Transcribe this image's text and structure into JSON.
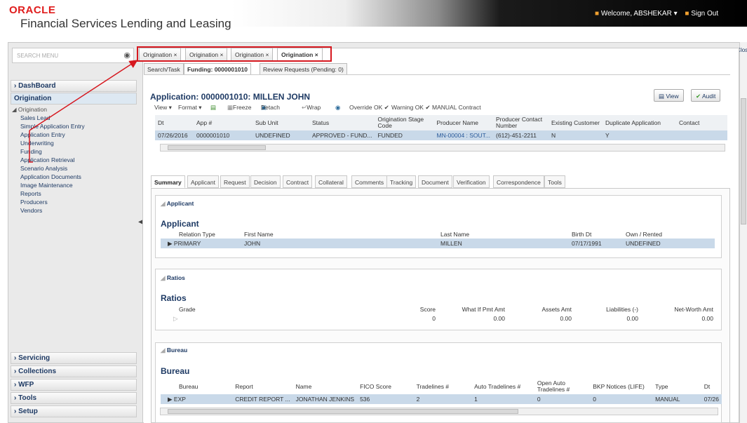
{
  "header": {
    "brand": "ORACLE",
    "subtitle": "Financial Services Lending and Leasing",
    "welcome": "Welcome, ABSHEKAR ▾",
    "signout": "Sign Out",
    "close": "Clos"
  },
  "sidebar": {
    "search_placeholder": "SEARCH MENU",
    "sections": {
      "dashboard": "DashBoard",
      "origination": "Origination",
      "servicing": "Servicing",
      "collections": "Collections",
      "wfp": "WFP",
      "tools": "Tools",
      "setup": "Setup"
    },
    "tree_root": "Origination",
    "items": [
      "Sales Lead",
      "Simple Application Entry",
      "Application Entry",
      "Underwriting",
      "Funding",
      "Application Retrieval",
      "Scenario Analysis",
      "Application Documents",
      "Image Maintenance",
      "Reports",
      "Producers",
      "Vendors"
    ]
  },
  "tabs": [
    "Origination ×",
    "Origination ×",
    "Origination ×",
    "Origination ×"
  ],
  "subtabs": [
    "Search/Task",
    "Funding: 0000001010",
    "Review Requests (Pending: 0)"
  ],
  "application": {
    "title": "Application: 0000001010: MILLEN JOHN",
    "view_btn": "View",
    "audit_btn": "Audit",
    "toolbar": [
      "View ▾",
      "Format ▾",
      "Freeze",
      "Detach",
      "Wrap",
      "Override OK ✔",
      "Warning OK ✔",
      "MANUAL Contract"
    ],
    "columns": [
      "Dt",
      "App #",
      "Sub Unit",
      "Status",
      "Origination Stage Code",
      "Producer Name",
      "Producer Contact Number",
      "Existing Customer",
      "Duplicate Application",
      "Contact"
    ],
    "row": [
      "07/26/2016",
      "0000001010",
      "UNDEFINED",
      "APPROVED - FUND...",
      "FUNDED",
      "MN-00004 : SOUT...",
      "(612)-451-2211",
      "N",
      "Y",
      ""
    ]
  },
  "detail_tabs": [
    "Summary",
    "Applicant",
    "Request",
    "Decision",
    "Contract",
    "Collateral",
    "Comments",
    "Tracking",
    "Document",
    "Verification",
    "Correspondence",
    "Tools"
  ],
  "applicant": {
    "section": "Applicant",
    "title": "Applicant",
    "columns": [
      "Relation Type",
      "First Name",
      "Last Name",
      "Birth Dt",
      "Own / Rented"
    ],
    "row": [
      "PRIMARY",
      "JOHN",
      "MILLEN",
      "07/17/1991",
      "UNDEFINED"
    ]
  },
  "ratios": {
    "section": "Ratios",
    "title": "Ratios",
    "columns": [
      "Grade",
      "Score",
      "What If Pmt Amt",
      "Assets Amt",
      "Liabilities (-)",
      "Net-Worth Amt"
    ],
    "row": [
      "",
      "0",
      "0.00",
      "0.00",
      "0.00",
      "0.00"
    ]
  },
  "bureau": {
    "section": "Bureau",
    "title": "Bureau",
    "columns": [
      "Bureau",
      "Report",
      "Name",
      "FICO Score",
      "Tradelines #",
      "Auto Tradelines #",
      "Open Auto Tradelines #",
      "BKP Notices (LIFE)",
      "Type",
      "Dt"
    ],
    "row": [
      "EXP",
      "CREDIT REPORT ...",
      "JONATHAN JENKINS",
      "536",
      "2",
      "1",
      "0",
      "0",
      "MANUAL",
      "07/26"
    ]
  }
}
